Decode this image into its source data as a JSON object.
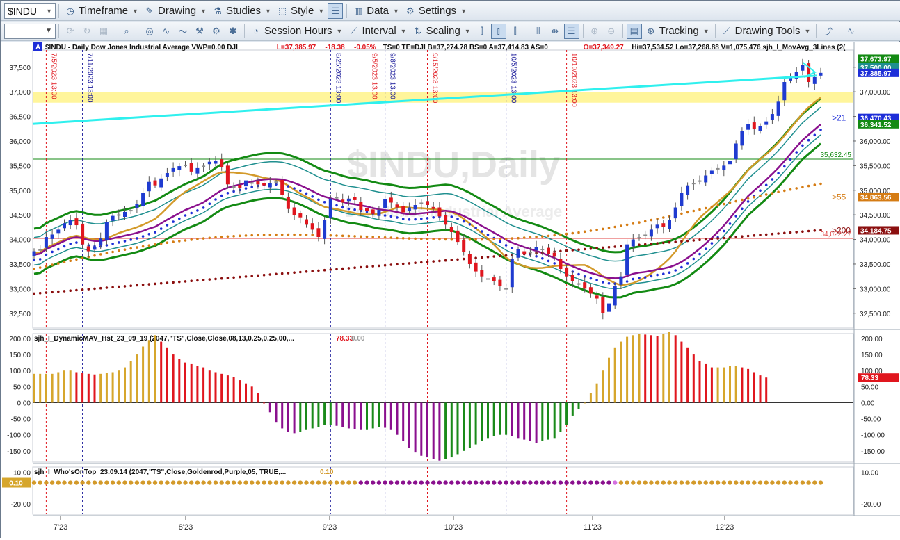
{
  "toolbar1": {
    "symbol": "$INDU",
    "timeframe": "Timeframe",
    "drawing": "Drawing",
    "studies": "Studies",
    "style": "Style",
    "data": "Data",
    "settings": "Settings"
  },
  "toolbar2": {
    "session_hours": "Session Hours",
    "interval": "Interval",
    "scaling": "Scaling",
    "tracking": "Tracking",
    "drawing_tools": "Drawing Tools"
  },
  "colors": {
    "up": "#1f3bd0",
    "down": "#e0161e",
    "doji": "#8c8c8c",
    "cyan": "#2ff0ee",
    "highlight": "#fff38a",
    "green": "#138a13",
    "teal": "#1f8f8f",
    "gold": "#d39a2a",
    "purple": "#8a108e",
    "blue": "#1e2ed8",
    "orange": "#d57c14",
    "maroon": "#8b0f0f",
    "hist_gold": "#d6a62c",
    "hist_red": "#e0161e",
    "hist_purple": "#8a108e",
    "hist_green": "#1a8a1a"
  },
  "header": {
    "marker": "A",
    "line": "$INDU - Daily  Dow Jones Industrial Average  VWP=0.00  DJI",
    "last": "L=37,385.97",
    "change": "-18.38",
    "change_pct": "-0.05%",
    "rest": "TS=0  TE=DJI  B=37,274.78  BS=0  A=37,414.83  AS=0",
    "open": "O=37,349.27",
    "tail": "Hi=37,534.52  Lo=37,268.88  V=1,075,476  sjh_I_MovAvg_3Lines (2("
  },
  "watermark": {
    "title": "$INDU,Daily",
    "subtitle": "Dow Jones Industrial Average"
  },
  "event_labels": [
    {
      "date": "7/5/2023 13:00",
      "color": "#e0161e"
    },
    {
      "date": "7/11/2023 13:00",
      "color": "#1a1a9a"
    },
    {
      "date": "8/25/2023 13:00",
      "color": "#1a1a9a"
    },
    {
      "date": "9/5/2023 13:00",
      "color": "#e0161e"
    },
    {
      "date": "9/8/2023 13:00",
      "color": "#1a1a9a"
    },
    {
      "date": "9/15/2023 13:00",
      "color": "#e0161e"
    },
    {
      "date": "10/5/2023 13:00",
      "color": "#1a1a9a"
    },
    {
      "date": "10/19/2023 13:00",
      "color": "#e0161e"
    }
  ],
  "chart_data": [
    {
      "type": "candlestick",
      "title": "$INDU - Daily",
      "y_ticks": [
        "37,500.00",
        "37,000.00",
        "36,500.00",
        "36,000.00",
        "35,500.00",
        "35,000.00",
        "34,500.00",
        "34,000.00",
        "33,500.00",
        "33,000.00",
        "32,500.00"
      ],
      "ylim": [
        32200,
        37850
      ],
      "x_ticks": [
        "7'23",
        "8'23",
        "9'23",
        "10'23",
        "11'23",
        "12'23"
      ],
      "close": [
        33760,
        33800,
        34050,
        34100,
        34200,
        34330,
        34400,
        34290,
        33900,
        33760,
        33850,
        34020,
        34350,
        34480,
        34500,
        34560,
        34600,
        34720,
        34950,
        35170,
        35100,
        35240,
        35350,
        35450,
        35490,
        35520,
        35380,
        35450,
        35500,
        35580,
        35600,
        35470,
        35120,
        35080,
        35050,
        35200,
        35150,
        35120,
        35100,
        35150,
        35180,
        34900,
        34620,
        34500,
        34450,
        34300,
        34200,
        34050,
        34400,
        34830,
        34850,
        34750,
        34830,
        34800,
        34600,
        34580,
        34520,
        34600,
        34820,
        34750,
        34650,
        34550,
        34650,
        34700,
        34750,
        34700,
        34620,
        34470,
        34300,
        34150,
        33950,
        33750,
        33500,
        33350,
        33250,
        33200,
        33150,
        33050,
        33000,
        33600,
        33800,
        33700,
        33750,
        33850,
        33800,
        33700,
        33650,
        33400,
        33250,
        33150,
        33100,
        33000,
        32900,
        32800,
        32500,
        32700,
        33050,
        33250,
        33900,
        34000,
        34050,
        34100,
        34200,
        34300,
        34250,
        34400,
        34650,
        34950,
        35100,
        35150,
        35200,
        35300,
        35400,
        35450,
        35500,
        35600,
        35950,
        36200,
        36350,
        36250,
        36300,
        36400,
        36550,
        36800,
        37200,
        37300,
        37400,
        37550,
        37200,
        37300,
        37385.97
      ],
      "series": [
        {
          "name": "sjh_I_DynamicMAV_Hst_23_09_19 (2047,\"TS\",Close,Close,08,13,0.25,0.25,00,...",
          "last": 78.33,
          "type": "histogram"
        },
        {
          "name": "sjh_I_Who'sOnTop_23.09.14 (2047,\"TS\",Close,Goldenrod,Purple,05,  TRUE,...",
          "last": 0.1,
          "type": "dots"
        }
      ],
      "histogram": [
        90,
        90,
        90,
        90,
        95,
        100,
        100,
        95,
        92,
        90,
        88,
        90,
        92,
        95,
        100,
        110,
        130,
        150,
        175,
        195,
        210,
        190,
        170,
        150,
        135,
        125,
        120,
        115,
        110,
        100,
        95,
        90,
        85,
        80,
        70,
        60,
        50,
        30,
        0,
        -30,
        -60,
        -80,
        -90,
        -95,
        -90,
        -85,
        -80,
        -75,
        -70,
        -70,
        -72,
        -75,
        -80,
        -82,
        -85,
        -85,
        -80,
        -75,
        -78,
        -85,
        -100,
        -120,
        -140,
        -155,
        -165,
        -170,
        -175,
        -180,
        -175,
        -170,
        -160,
        -150,
        -140,
        -130,
        -120,
        -110,
        -105,
        -100,
        -100,
        -105,
        -110,
        -115,
        -120,
        -125,
        -120,
        -115,
        -110,
        -90,
        -70,
        -40,
        -20,
        0,
        30,
        60,
        100,
        140,
        170,
        190,
        205,
        210,
        215,
        212,
        210,
        208,
        215,
        220,
        210,
        190,
        170,
        150,
        130,
        120,
        110,
        110,
        110,
        115,
        115,
        110,
        105,
        95,
        85,
        78.33
      ],
      "hist_ticks": [
        "200.00",
        "150.00",
        "100.00",
        "50.00",
        "0.00",
        "-50.00",
        "-100.00",
        "-150.00"
      ],
      "dots_ticks": [
        "10.00",
        "-20.00"
      ],
      "axis_labels": [
        {
          "text": "37,673.97",
          "value": 37673.97,
          "bg": "#138a13"
        },
        {
          "text": "37,500.00",
          "value": 37500,
          "bg": "#1f8f8f"
        },
        {
          "text": "37,385.97",
          "value": 37385.97,
          "bg": "#1e2ed8"
        },
        {
          "text": "37,000.00",
          "value": 37000,
          "bg": ""
        },
        {
          "text": "36,470.43",
          "value": 36470.43,
          "bg": "#1e2ed8"
        },
        {
          "text": "36,341.52",
          "value": 36341.52,
          "bg": "#138a13"
        },
        {
          "text": "34,863.56",
          "value": 34863.56,
          "bg": "#d57c14"
        },
        {
          "text": "34,184.75",
          "value": 34184.75,
          "bg": "#8b0f0f"
        }
      ],
      "hline_labels": [
        {
          "text": "35,632.45",
          "value": 35632.45,
          "color": "#138a13"
        },
        {
          "text": "34,022.27",
          "value": 34022.27,
          "color": "#e04040"
        }
      ],
      "ma_labels": [
        {
          "text": ">21",
          "value": 36470,
          "color": "#1e2ed8"
        },
        {
          "text": ">55",
          "value": 34863,
          "color": "#d57c14"
        },
        {
          "text": ">200",
          "value": 34184,
          "color": "#8b0f0f"
        }
      ],
      "hist_last_label": "78.33",
      "hist_second": "0.00",
      "dots_last_label": "0.10"
    }
  ]
}
